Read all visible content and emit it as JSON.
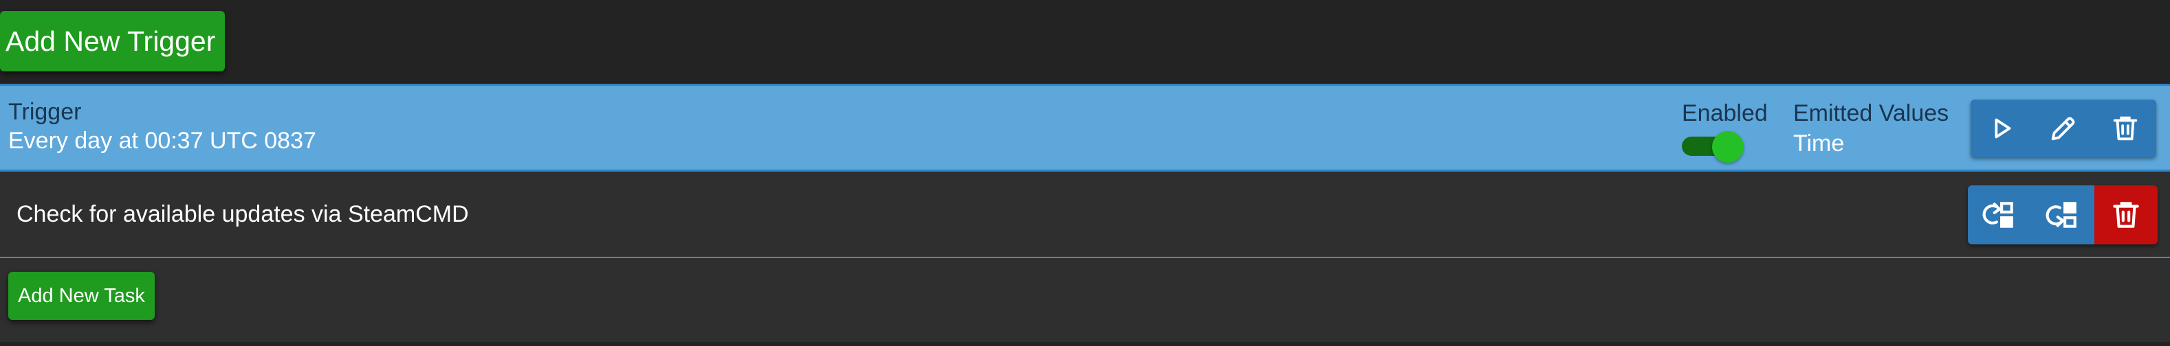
{
  "toolbar": {
    "add_trigger_label": "Add New Trigger"
  },
  "trigger": {
    "title": "Trigger",
    "description": "Every day at 00:37 UTC 0837",
    "enabled_label": "Enabled",
    "enabled": true,
    "emitted_values_label": "Emitted Values",
    "emitted_values": "Time",
    "actions": [
      "play-icon",
      "pencil-icon",
      "trash-icon"
    ]
  },
  "tasks": [
    {
      "label": "Check for available updates via SteamCMD",
      "actions": [
        "move-task-up-icon",
        "move-task-down-icon",
        "trash-icon"
      ]
    }
  ],
  "add_task_label": "Add New Task",
  "colors": {
    "background": "#232323",
    "green_button": "#1f9b1f",
    "trigger_header": "#5ea7db",
    "action_blue": "#2e78b5",
    "danger_red": "#c40d0d",
    "toggle_on": "#25c025"
  }
}
